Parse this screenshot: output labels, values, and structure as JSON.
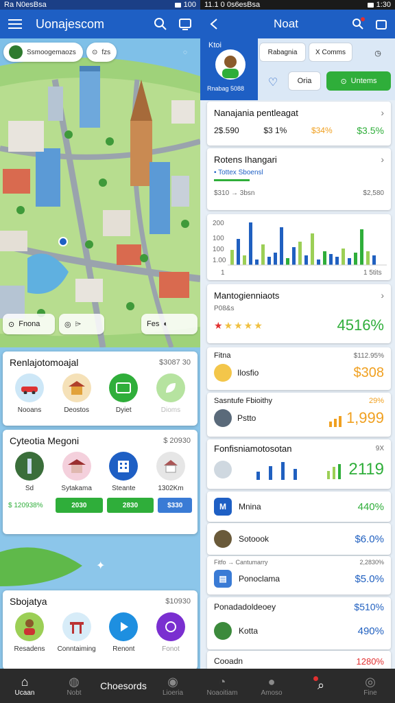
{
  "status": {
    "left_text": "Ra N0esBsa",
    "left_time": "100",
    "right_text": "11.1 0 0s6esBsa",
    "right_time": "1:30"
  },
  "left": {
    "title": "Uonajescom",
    "map": {
      "location_chip": "Ssmoogemaozs",
      "chip2": "fzs",
      "bottom_a": "Fnona",
      "bottom_b": "Fes"
    },
    "card1": {
      "title": "Renlajotomoajal",
      "amount": "$3087 30",
      "items": [
        {
          "label": "Nooans",
          "icon": "car-icon"
        },
        {
          "label": "Deostos",
          "icon": "temple-icon"
        },
        {
          "label": "Dyiet",
          "icon": "wallet-icon"
        },
        {
          "label": "Dioms",
          "icon": "leaf-icon"
        }
      ]
    },
    "card2": {
      "title": "Cyteotia Megoni",
      "amount": "$ 20930",
      "items": [
        {
          "label": "Sd",
          "icon": "statue-icon"
        },
        {
          "label": "Sytakama",
          "icon": "pagoda-icon"
        },
        {
          "label": "Steante",
          "icon": "building-icon"
        },
        {
          "label": "1302Km",
          "icon": "house-icon"
        }
      ],
      "footer_value": "$ 120938%",
      "btn1": "2030",
      "btn2": "2830",
      "btn3": "$330"
    },
    "card3": {
      "title": "Sbojatya",
      "amount": "$10930",
      "items": [
        {
          "label": "Resadens",
          "icon": "person-icon"
        },
        {
          "label": "Conntaiming",
          "icon": "gate-icon"
        },
        {
          "label": "Renont",
          "icon": "play-icon"
        },
        {
          "label": "Fonot",
          "icon": "stop-icon"
        }
      ]
    }
  },
  "right": {
    "title": "Noat",
    "profile": {
      "name": "Ktoi",
      "sub": "Rnabag 5088",
      "chip1": "Rabagnia",
      "chip2": "X Comms",
      "btn1": "Oria",
      "btn2": "Untems"
    },
    "card1": {
      "title": "Nanajania pentleagat",
      "v1": "2$.590",
      "v2": "$3 1%",
      "v3": "$34%",
      "v4": "$3.5%"
    },
    "card2": {
      "title": "Rotens Ihangari",
      "sub": "Tottex Sboensl",
      "left": "$310 → 3bsn",
      "right": "$2,580"
    },
    "chart": {
      "y_labels": [
        "200",
        "100",
        "100",
        "1.00"
      ],
      "x_left": "1",
      "x_right": "1 5tits"
    },
    "card3": {
      "title": "Mantogienniaots",
      "sub": "P08&s",
      "big": "4516%"
    },
    "card4": {
      "label": "Fitna",
      "name": "Ilosfio",
      "right_top": "$112.95%",
      "right_big": "$308"
    },
    "card5": {
      "label": "Sasntufe Fbioithy",
      "name": "Pstto",
      "right_top": "29%",
      "right_big": "1,999"
    },
    "card6": {
      "title": "Fonfisniamotosotan",
      "pct": "9X",
      "big": "2119"
    },
    "list": [
      {
        "name": "Mnina",
        "value": "440%",
        "color": "green",
        "icon": "badge-icon"
      },
      {
        "name": "Sotoook",
        "value": "$6.0%",
        "color": "blue",
        "icon": "avatar-icon"
      },
      {
        "name": "Ponoclama",
        "value": "$5.0%",
        "color": "blue",
        "icon": "doc-icon",
        "label": "Fitfo → Cantumarry",
        "label_right": "2,2830%"
      },
      {
        "name": "Kotta",
        "value": "490%",
        "color": "blue",
        "icon": "avatar-icon",
        "label": "Ponadadoldeoey",
        "label_right": "$510%"
      }
    ],
    "last": {
      "name": "Cooadn",
      "value": "1280%"
    }
  },
  "nav": [
    {
      "label": "Ucaan",
      "icon": "home-icon"
    },
    {
      "label": "Nobt",
      "icon": "globe-icon"
    },
    {
      "label": "Choesords",
      "icon": "text-icon"
    },
    {
      "label": "Lioeria",
      "icon": "person-icon"
    },
    {
      "label": "Noaoitiam",
      "icon": "chart-icon"
    },
    {
      "label": "Amoso",
      "icon": "drop-icon"
    },
    {
      "label": "",
      "icon": "search-icon"
    },
    {
      "label": "Fine",
      "icon": "pin-icon"
    }
  ],
  "colors": {
    "primary": "#1e5fc4",
    "green": "#2fae3a",
    "orange": "#f0a020",
    "blue": "#2060c0"
  }
}
